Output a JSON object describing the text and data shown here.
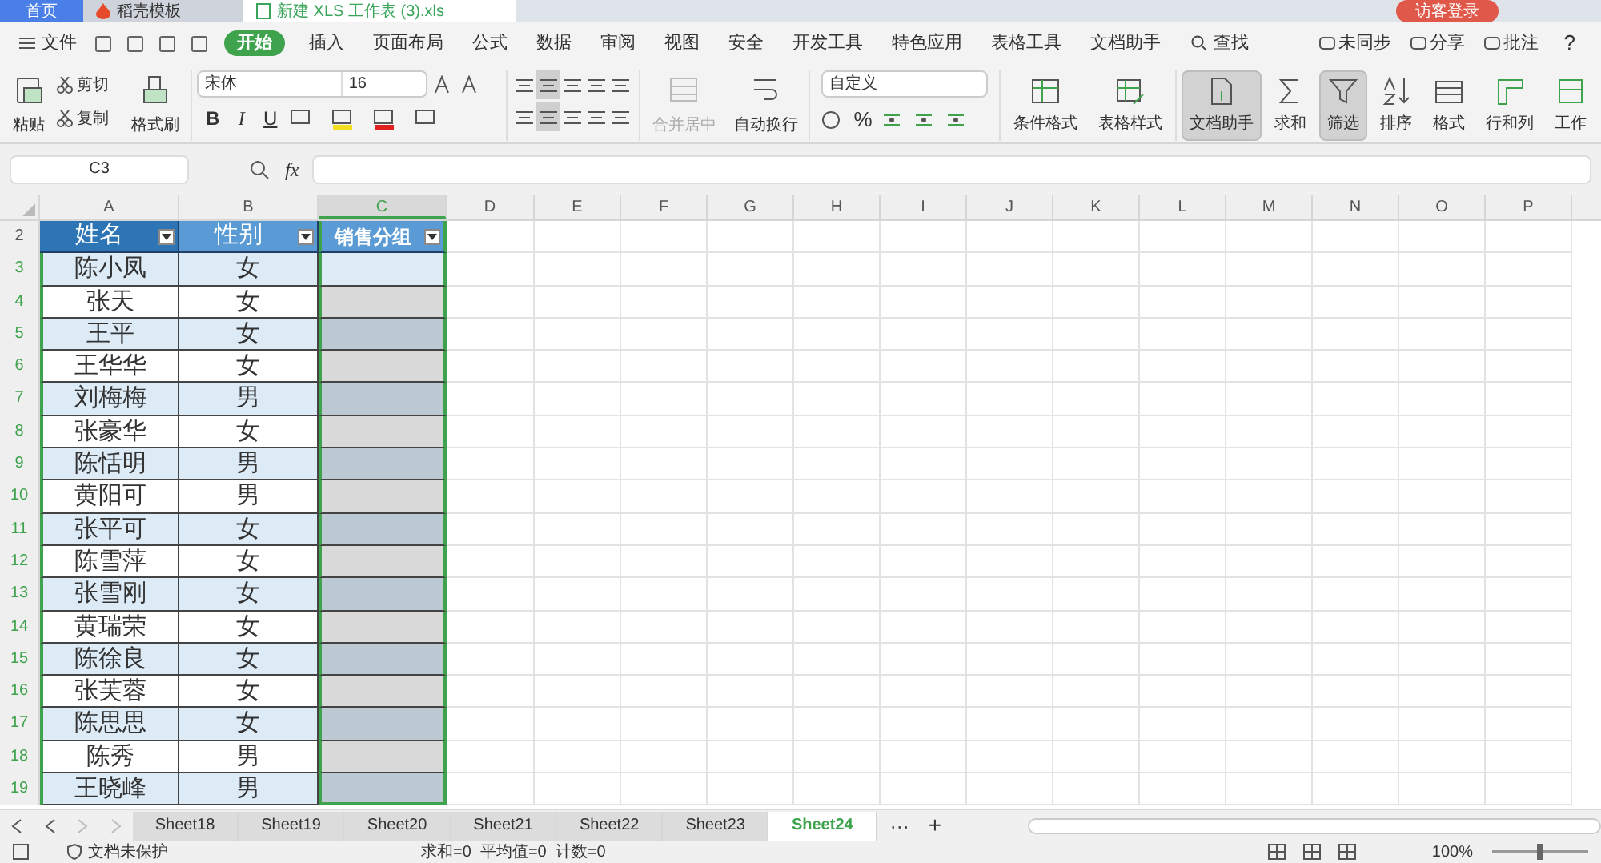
{
  "doc_tabs": [
    {
      "label": "首页",
      "selected": false,
      "kind": "home"
    },
    {
      "label": "稻壳模板",
      "selected": false,
      "kind": "template"
    },
    {
      "label": "新建 XLS 工作表 (3).xls",
      "selected": true,
      "kind": "file"
    }
  ],
  "login_button": "访客登录",
  "file_menu": "文件",
  "menu_tabs": [
    {
      "label": "开始",
      "selected": true
    },
    {
      "label": "插入",
      "selected": false
    },
    {
      "label": "页面布局",
      "selected": false
    },
    {
      "label": "公式",
      "selected": false
    },
    {
      "label": "数据",
      "selected": false
    },
    {
      "label": "审阅",
      "selected": false
    },
    {
      "label": "视图",
      "selected": false
    },
    {
      "label": "安全",
      "selected": false
    },
    {
      "label": "开发工具",
      "selected": false
    },
    {
      "label": "特色应用",
      "selected": false
    },
    {
      "label": "表格工具",
      "selected": false
    },
    {
      "label": "文档助手",
      "selected": false
    }
  ],
  "search_label": "查找",
  "right_actions": [
    "未同步",
    "分享",
    "批注"
  ],
  "help_label": "?",
  "clipboard": {
    "paste": "粘贴",
    "cut": "剪切",
    "copy": "复制",
    "format_painter": "格式刷"
  },
  "font_name": "宋体",
  "font_size": "16",
  "style_buttons": [
    "B",
    "I",
    "U"
  ],
  "merge_button": {
    "label": "合并居中",
    "disabled": true
  },
  "wrap_button": "自动换行",
  "number_format": "自定义",
  "percent_button": "%",
  "tool_buttons": [
    {
      "label": "条件格式",
      "pressed": false
    },
    {
      "label": "表格样式",
      "pressed": false
    },
    {
      "label": "文档助手",
      "pressed": true
    },
    {
      "label": "求和",
      "pressed": false
    },
    {
      "label": "筛选",
      "pressed": true
    },
    {
      "label": "排序",
      "pressed": false
    },
    {
      "label": "格式",
      "pressed": false
    },
    {
      "label": "行和列",
      "pressed": false
    },
    {
      "label": "工作",
      "pressed": false
    }
  ],
  "name_box": "C3",
  "fx_label": "fx",
  "columns": [
    {
      "letter": "A",
      "selected": false
    },
    {
      "letter": "B",
      "selected": false
    },
    {
      "letter": "C",
      "selected": true
    },
    {
      "letter": "D",
      "selected": false
    },
    {
      "letter": "E",
      "selected": false
    },
    {
      "letter": "F",
      "selected": false
    },
    {
      "letter": "G",
      "selected": false
    },
    {
      "letter": "H",
      "selected": false
    },
    {
      "letter": "I",
      "selected": false
    },
    {
      "letter": "J",
      "selected": false
    },
    {
      "letter": "K",
      "selected": false
    },
    {
      "letter": "L",
      "selected": false
    },
    {
      "letter": "M",
      "selected": false
    },
    {
      "letter": "N",
      "selected": false
    },
    {
      "letter": "O",
      "selected": false
    },
    {
      "letter": "P",
      "selected": false
    }
  ],
  "header_row": {
    "number": "2",
    "cells": [
      "姓名",
      "性别",
      "销售分组"
    ]
  },
  "rows": [
    {
      "number": "3",
      "name": "陈小凤",
      "gender": "女"
    },
    {
      "number": "4",
      "name": "张天",
      "gender": "女"
    },
    {
      "number": "5",
      "name": "王平",
      "gender": "女"
    },
    {
      "number": "6",
      "name": "王华华",
      "gender": "女"
    },
    {
      "number": "7",
      "name": "刘梅梅",
      "gender": "男"
    },
    {
      "number": "8",
      "name": "张豪华",
      "gender": "女"
    },
    {
      "number": "9",
      "name": "陈恬明",
      "gender": "男"
    },
    {
      "number": "10",
      "name": "黄阳可",
      "gender": "男"
    },
    {
      "number": "11",
      "name": "张平可",
      "gender": "女"
    },
    {
      "number": "12",
      "name": "陈雪萍",
      "gender": "女"
    },
    {
      "number": "13",
      "name": "张雪刚",
      "gender": "女"
    },
    {
      "number": "14",
      "name": "黄瑞荣",
      "gender": "女"
    },
    {
      "number": "15",
      "name": "陈徐良",
      "gender": "女"
    },
    {
      "number": "16",
      "name": "张芙蓉",
      "gender": "女"
    },
    {
      "number": "17",
      "name": "陈思思",
      "gender": "女"
    },
    {
      "number": "18",
      "name": "陈秀",
      "gender": "男"
    },
    {
      "number": "19",
      "name": "王晓峰",
      "gender": "男"
    }
  ],
  "sheets": [
    {
      "label": "Sheet18",
      "selected": false
    },
    {
      "label": "Sheet19",
      "selected": false
    },
    {
      "label": "Sheet20",
      "selected": false
    },
    {
      "label": "Sheet21",
      "selected": false
    },
    {
      "label": "Sheet22",
      "selected": false
    },
    {
      "label": "Sheet23",
      "selected": false
    },
    {
      "label": "Sheet24",
      "selected": true
    }
  ],
  "more_sheets": "···",
  "add_sheet": "+",
  "status_bar": {
    "protection": "文档未保护",
    "stats": "求和=0  平均值=0  计数=0",
    "zoom": "100%",
    "zoom_slider": {
      "level": 0.5
    }
  }
}
